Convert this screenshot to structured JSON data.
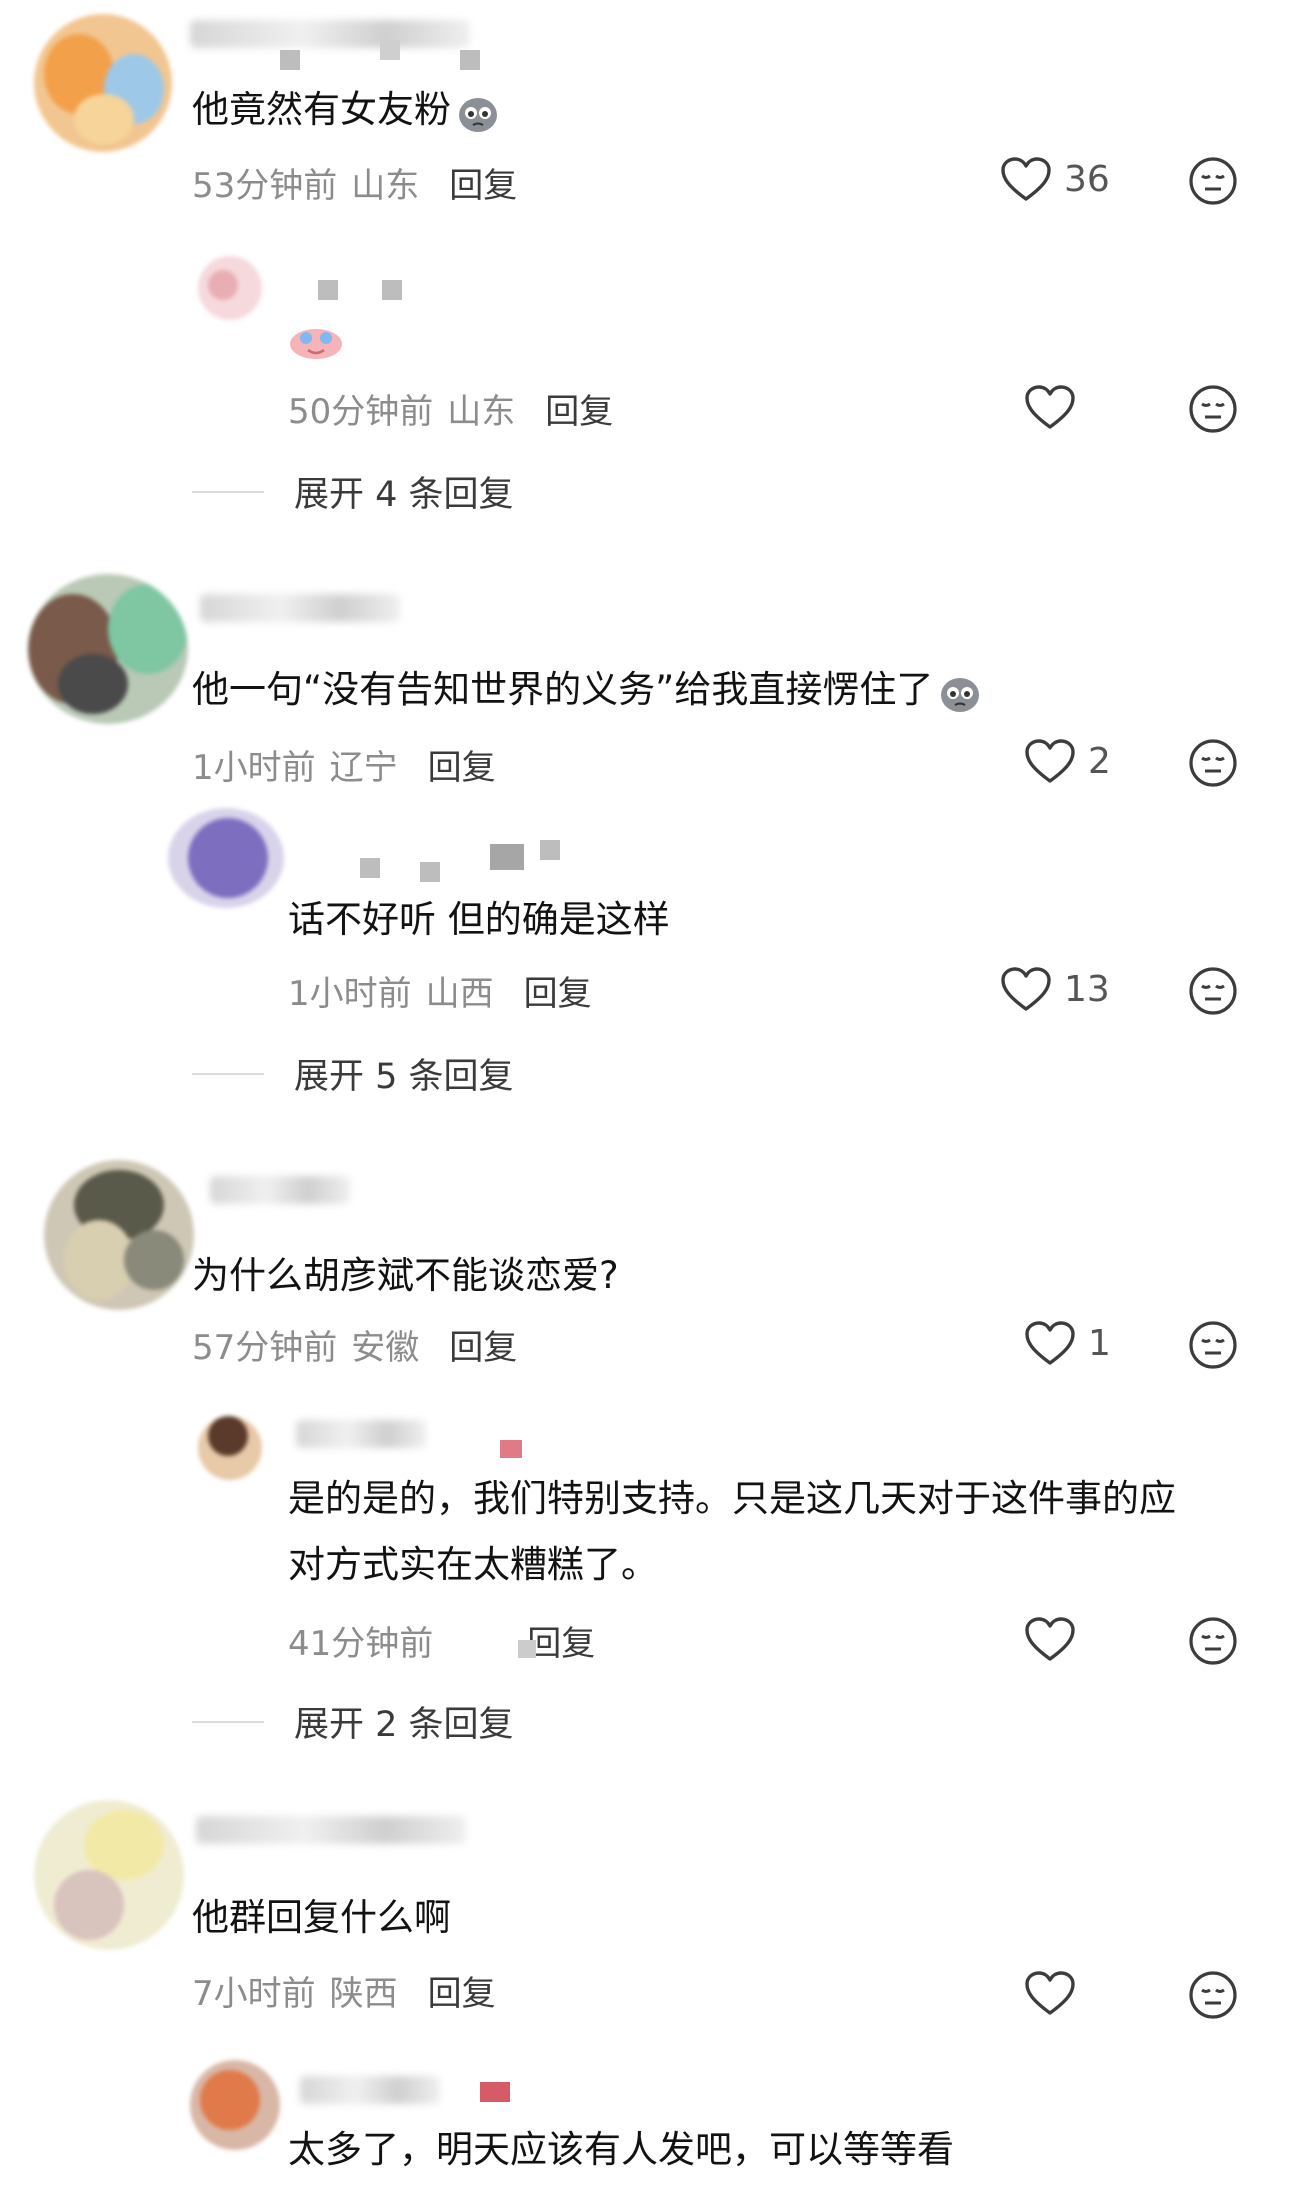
{
  "threads": [
    {
      "text": "他竟然有女友粉",
      "time": "53分钟前",
      "location": "山东",
      "reply_label": "回复",
      "likes": "36",
      "reply": {
        "time": "50分钟前",
        "location": "山东",
        "reply_label": "回复",
        "likes": ""
      },
      "expand_label": "展开 4 条回复"
    },
    {
      "text": "他一句“没有告知世界的义务”给我直接愣住了",
      "time": "1小时前",
      "location": "辽宁",
      "reply_label": "回复",
      "likes": "2",
      "reply": {
        "text": "话不好听 但的确是这样",
        "time": "1小时前",
        "location": "山西",
        "reply_label": "回复",
        "likes": "13"
      },
      "expand_label": "展开 5 条回复"
    },
    {
      "text": "为什么胡彦斌不能谈恋爱?",
      "time": "57分钟前",
      "location": "安徽",
      "reply_label": "回复",
      "likes": "1",
      "reply": {
        "text": "是的是的，我们特别支持。只是这几天对于这件事的应对方式实在太糟糕了。",
        "time": "41分钟前",
        "location": "",
        "reply_label": "回复",
        "likes": ""
      },
      "expand_label": "展开 2 条回复"
    },
    {
      "text": "他群回复什么啊",
      "time": "7小时前",
      "location": "陕西",
      "reply_label": "回复",
      "likes": "",
      "reply": {
        "text": "太多了，明天应该有人发吧，可以等等看"
      }
    }
  ],
  "icons": {
    "like": "heart-outline-icon",
    "dislike": "meh-face-icon",
    "emoji_sticker": "pleading-emoji-icon",
    "emoji_cry": "crying-emoji-icon"
  },
  "colors": {
    "meta_gray": "#8c8c8c",
    "reply_dark": "#3a3a3a",
    "text": "#121212",
    "icon_stroke": "#3c3c3c"
  }
}
